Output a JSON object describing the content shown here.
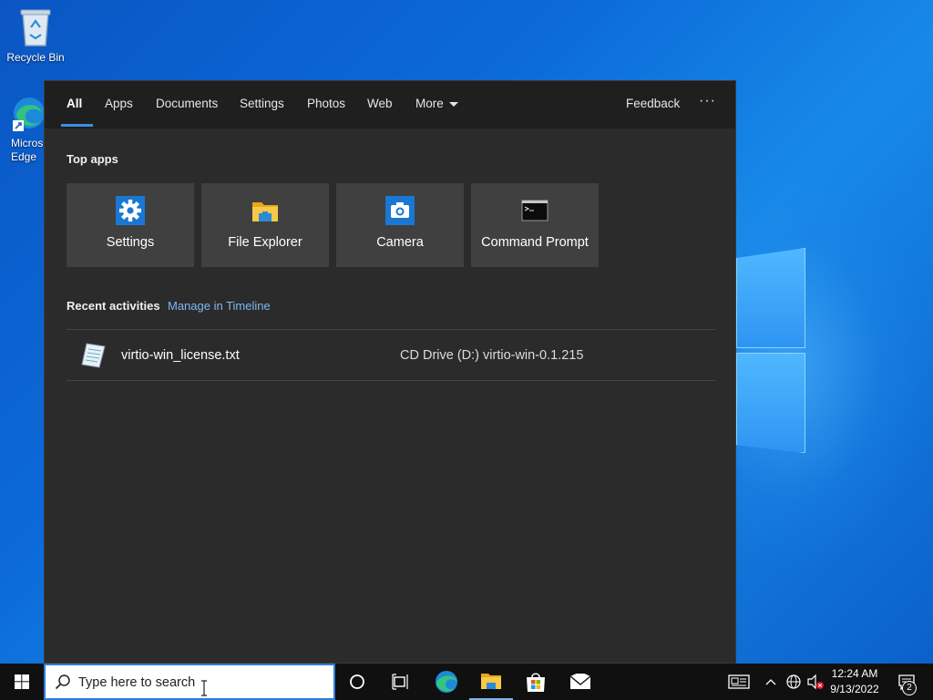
{
  "desktop": {
    "icons": [
      {
        "label": "Recycle Bin"
      },
      {
        "label": "Microsoft Edge"
      }
    ]
  },
  "search_flyout": {
    "tabs": [
      {
        "label": "All",
        "active": true
      },
      {
        "label": "Apps"
      },
      {
        "label": "Documents"
      },
      {
        "label": "Settings"
      },
      {
        "label": "Photos"
      },
      {
        "label": "Web"
      },
      {
        "label": "More"
      }
    ],
    "feedback_label": "Feedback",
    "more_options_label": "···",
    "top_apps_title": "Top apps",
    "top_apps": [
      {
        "label": "Settings",
        "icon": "settings-gear-icon"
      },
      {
        "label": "File Explorer",
        "icon": "file-explorer-icon"
      },
      {
        "label": "Camera",
        "icon": "camera-icon"
      },
      {
        "label": "Command Prompt",
        "icon": "command-prompt-icon"
      }
    ],
    "recent_title": "Recent activities",
    "manage_timeline_label": "Manage in Timeline",
    "recent_items": [
      {
        "name": "virtio-win_license.txt",
        "location": "CD Drive (D:) virtio-win-0.1.215",
        "icon": "text-file-icon"
      }
    ]
  },
  "taskbar": {
    "search_placeholder": "Type here to search",
    "pinned": [
      {
        "name": "cortana-icon"
      },
      {
        "name": "task-view-icon"
      },
      {
        "name": "edge-icon"
      },
      {
        "name": "file-explorer-icon"
      },
      {
        "name": "store-icon"
      },
      {
        "name": "mail-icon"
      }
    ],
    "clock_time": "12:24 AM",
    "clock_date": "9/13/2022",
    "notification_count": "2",
    "accent_color": "#2f7dd8"
  }
}
